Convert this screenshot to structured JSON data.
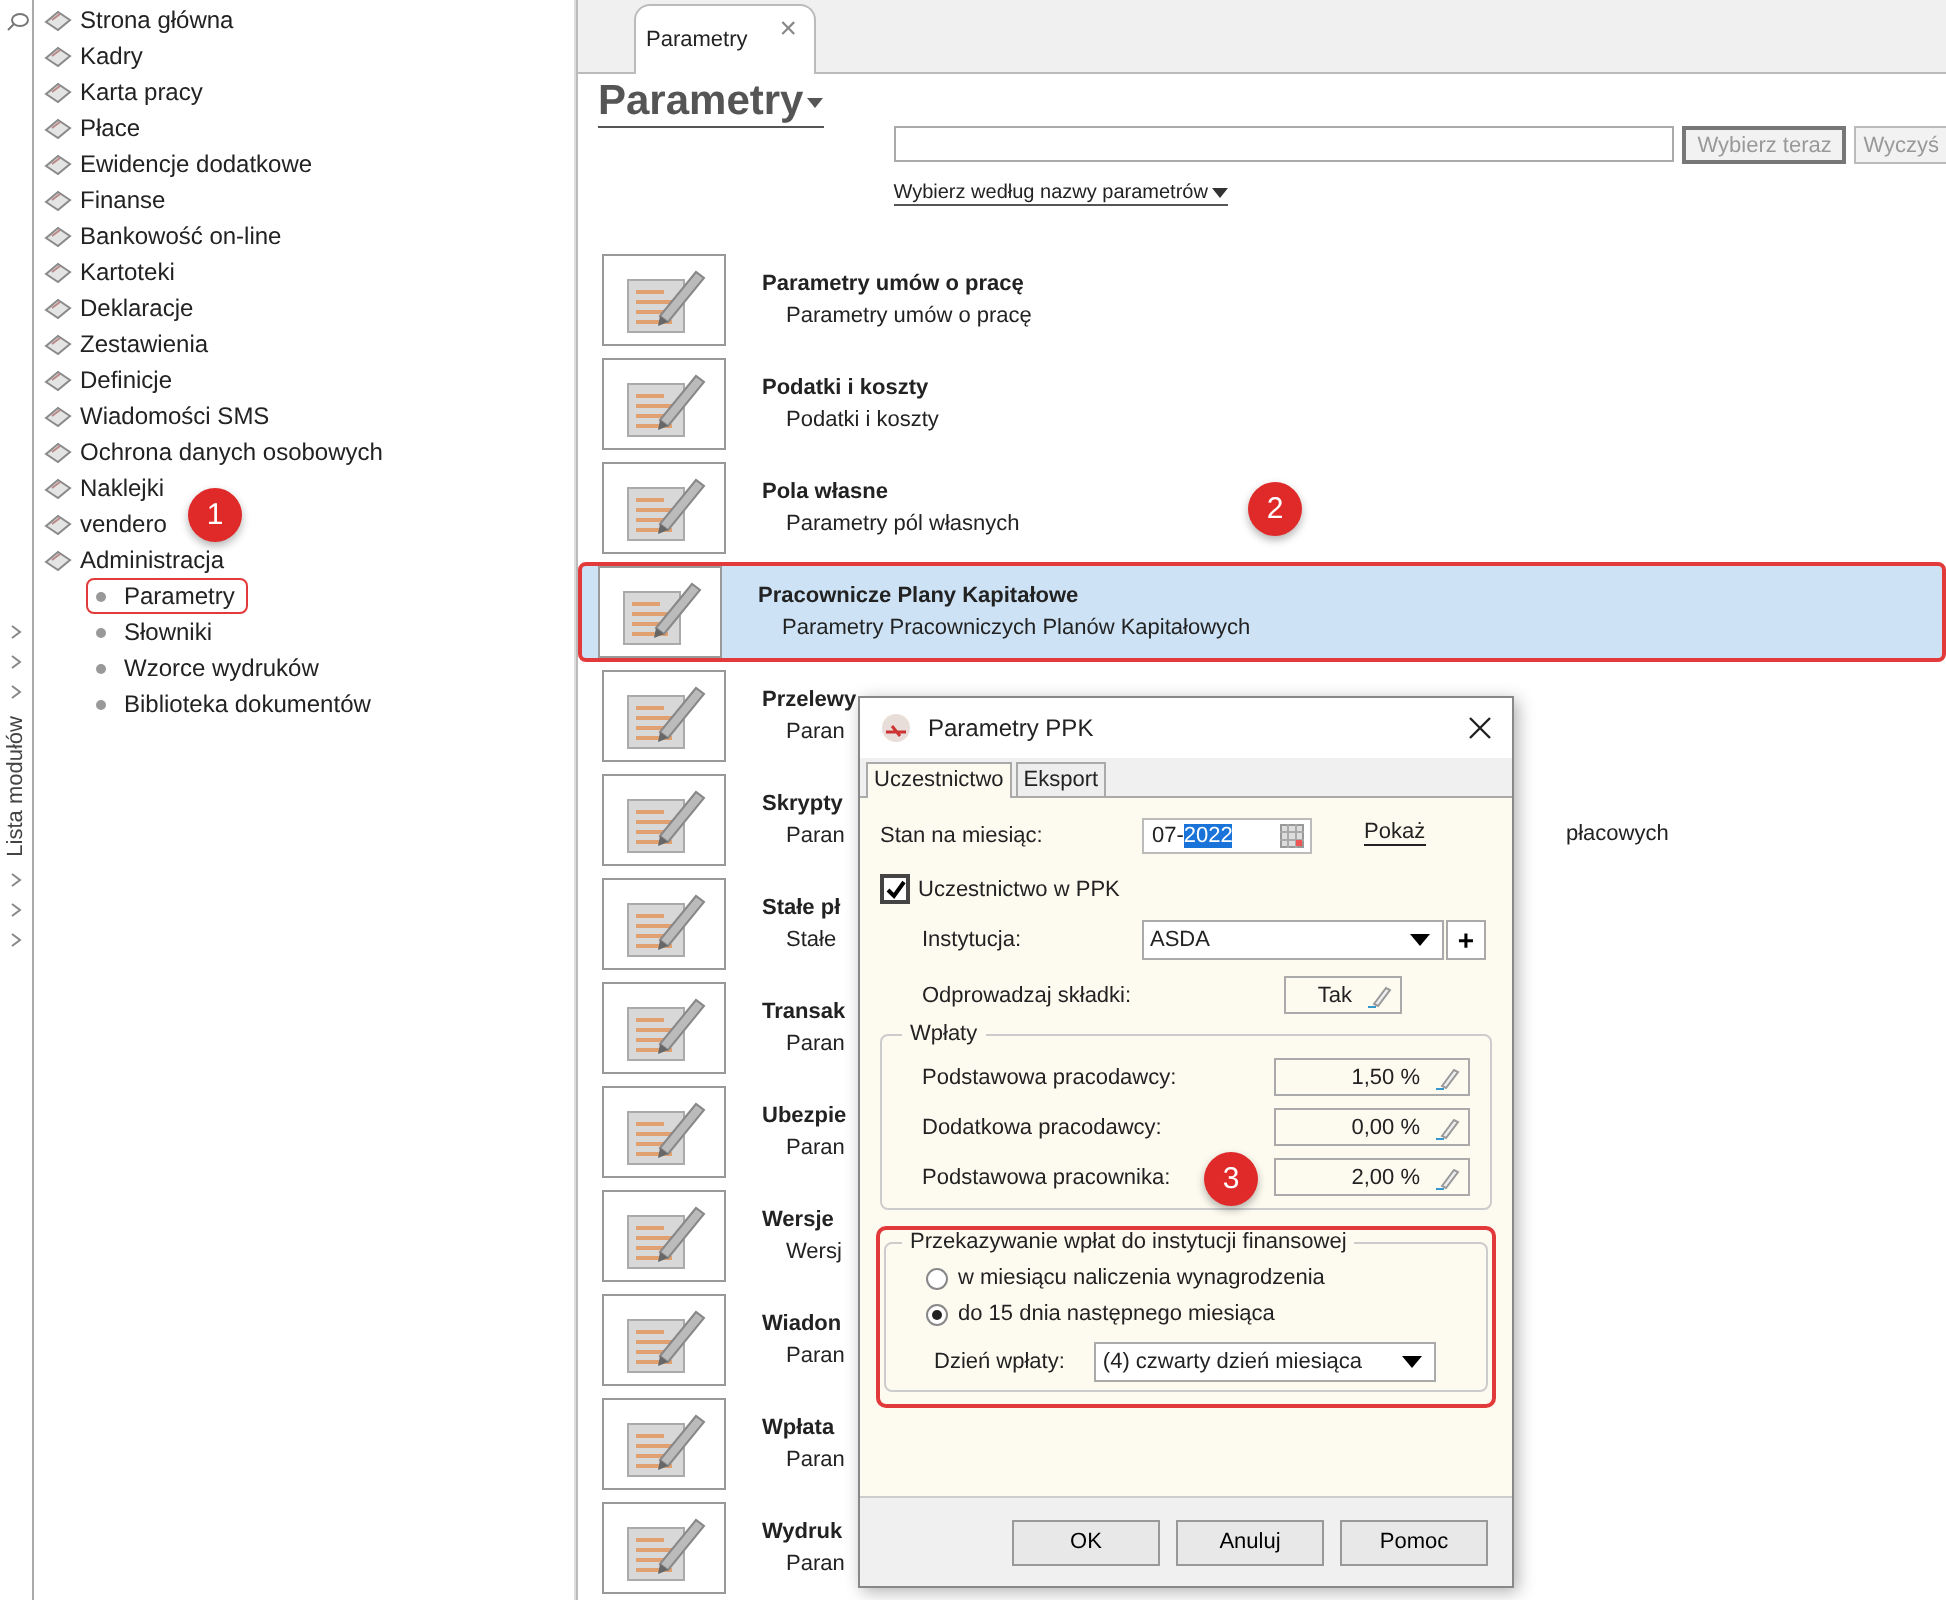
{
  "side_strip": {
    "label": "Lista modułów"
  },
  "modules": [
    {
      "label": "Strona główna"
    },
    {
      "label": "Kadry"
    },
    {
      "label": "Karta pracy"
    },
    {
      "label": "Płace"
    },
    {
      "label": "Ewidencje dodatkowe"
    },
    {
      "label": "Finanse"
    },
    {
      "label": "Bankowość on-line"
    },
    {
      "label": "Kartoteki"
    },
    {
      "label": "Deklaracje"
    },
    {
      "label": "Zestawienia"
    },
    {
      "label": "Definicje"
    },
    {
      "label": "Wiadomości SMS"
    },
    {
      "label": "Ochrona danych osobowych"
    },
    {
      "label": "Naklejki"
    },
    {
      "label": "vendero"
    },
    {
      "label": "Administracja",
      "children": [
        {
          "label": "Parametry",
          "annotated": true
        },
        {
          "label": "Słowniki",
          "annotated": false
        },
        {
          "label": "Wzorce wydruków",
          "annotated": false
        },
        {
          "label": "Biblioteka dokumentów",
          "annotated": false
        }
      ]
    }
  ],
  "tabs": [
    {
      "label": "Parametry",
      "close": "×",
      "selected": true
    }
  ],
  "heading": "Parametry",
  "search": {
    "button": "Wybierz teraz",
    "clear_button": "Wyczyś",
    "filter_link": "Wybierz według nazwy parametrów"
  },
  "rows": [
    {
      "title": "Parametry umów o pracę",
      "subtitle": "Parametry umów o pracę",
      "selected": false
    },
    {
      "title": "Podatki i koszty",
      "subtitle": "Podatki i koszty",
      "selected": false
    },
    {
      "title": "Pola własne",
      "subtitle": "Parametry pól własnych",
      "selected": false
    },
    {
      "title": "Pracownicze Plany Kapitałowe",
      "subtitle": "Parametry Pracowniczych Planów Kapitałowych",
      "selected": true
    },
    {
      "title": "Przelewy",
      "subtitle": "Paran",
      "selected": false
    },
    {
      "title": "Skrypty",
      "subtitle": "Paran",
      "subtitle_tail": "płacowych",
      "selected": false
    },
    {
      "title": "Stałe pł",
      "subtitle": "Stałe",
      "selected": false
    },
    {
      "title": "Transak",
      "subtitle": "Paran",
      "selected": false
    },
    {
      "title": "Ubezpie",
      "subtitle": "Paran",
      "selected": false
    },
    {
      "title": "Wersje",
      "subtitle": "Wersj",
      "selected": false
    },
    {
      "title": "Wiadon",
      "subtitle": "Paran",
      "selected": false
    },
    {
      "title": "Wpłata",
      "subtitle": "Paran",
      "selected": false
    },
    {
      "title": "Wydruk",
      "subtitle": "Paran",
      "selected": false
    }
  ],
  "dialog": {
    "title": "Parametry PPK",
    "tabs": [
      {
        "label": "Uczestnictwo",
        "selected": true
      },
      {
        "label": "Eksport",
        "selected": false
      }
    ],
    "month": {
      "label": "Stan na miesiąc:",
      "value": "07-",
      "selection": "2022",
      "link": "Pokaż"
    },
    "participation": {
      "label": "Uczestnictwo w PPK",
      "checked": true
    },
    "institution": {
      "label": "Instytucja:",
      "value": "ASDA",
      "add": "+"
    },
    "transfer": {
      "label": "Odprowadzaj składki:",
      "value": "Tak"
    },
    "payments": {
      "title": "Wpłaty",
      "rows": [
        {
          "label": "Podstawowa pracodawcy:",
          "value": "1,50 %"
        },
        {
          "label": "Dodatkowa pracodawcy:",
          "value": "0,00 %"
        },
        {
          "label": "Podstawowa pracownika:",
          "value": "2,00 %"
        }
      ]
    },
    "forwarding": {
      "title": "Przekazywanie wpłat do instytucji finansowej",
      "annotated": true,
      "options": [
        {
          "label": "w miesiącu naliczenia wynagrodzenia",
          "selected": false
        },
        {
          "label": "do 15 dnia następnego miesiąca",
          "selected": true
        }
      ],
      "day": {
        "label": "Dzień wpłaty:",
        "value": "(4) czwarty dzień miesiąca"
      }
    },
    "buttons": [
      "OK",
      "Anuluj",
      "Pomoc"
    ]
  },
  "callouts": [
    {
      "label": "1"
    },
    {
      "label": "2"
    },
    {
      "label": "3"
    }
  ]
}
